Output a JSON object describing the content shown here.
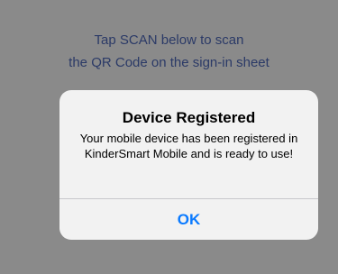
{
  "background": {
    "instruction_line1": "Tap SCAN below to scan",
    "instruction_line2": "the QR Code on the sign-in sheet"
  },
  "alert": {
    "title": "Device Registered",
    "message": "Your mobile device has been registered in KinderSmart Mobile and is ready to use!",
    "ok_label": "OK"
  },
  "colors": {
    "dimmed_background": "#8a8a8a",
    "instruction_text": "#2b3a67",
    "alert_background": "#f2f2f2",
    "button_tint": "#0a7aff"
  }
}
